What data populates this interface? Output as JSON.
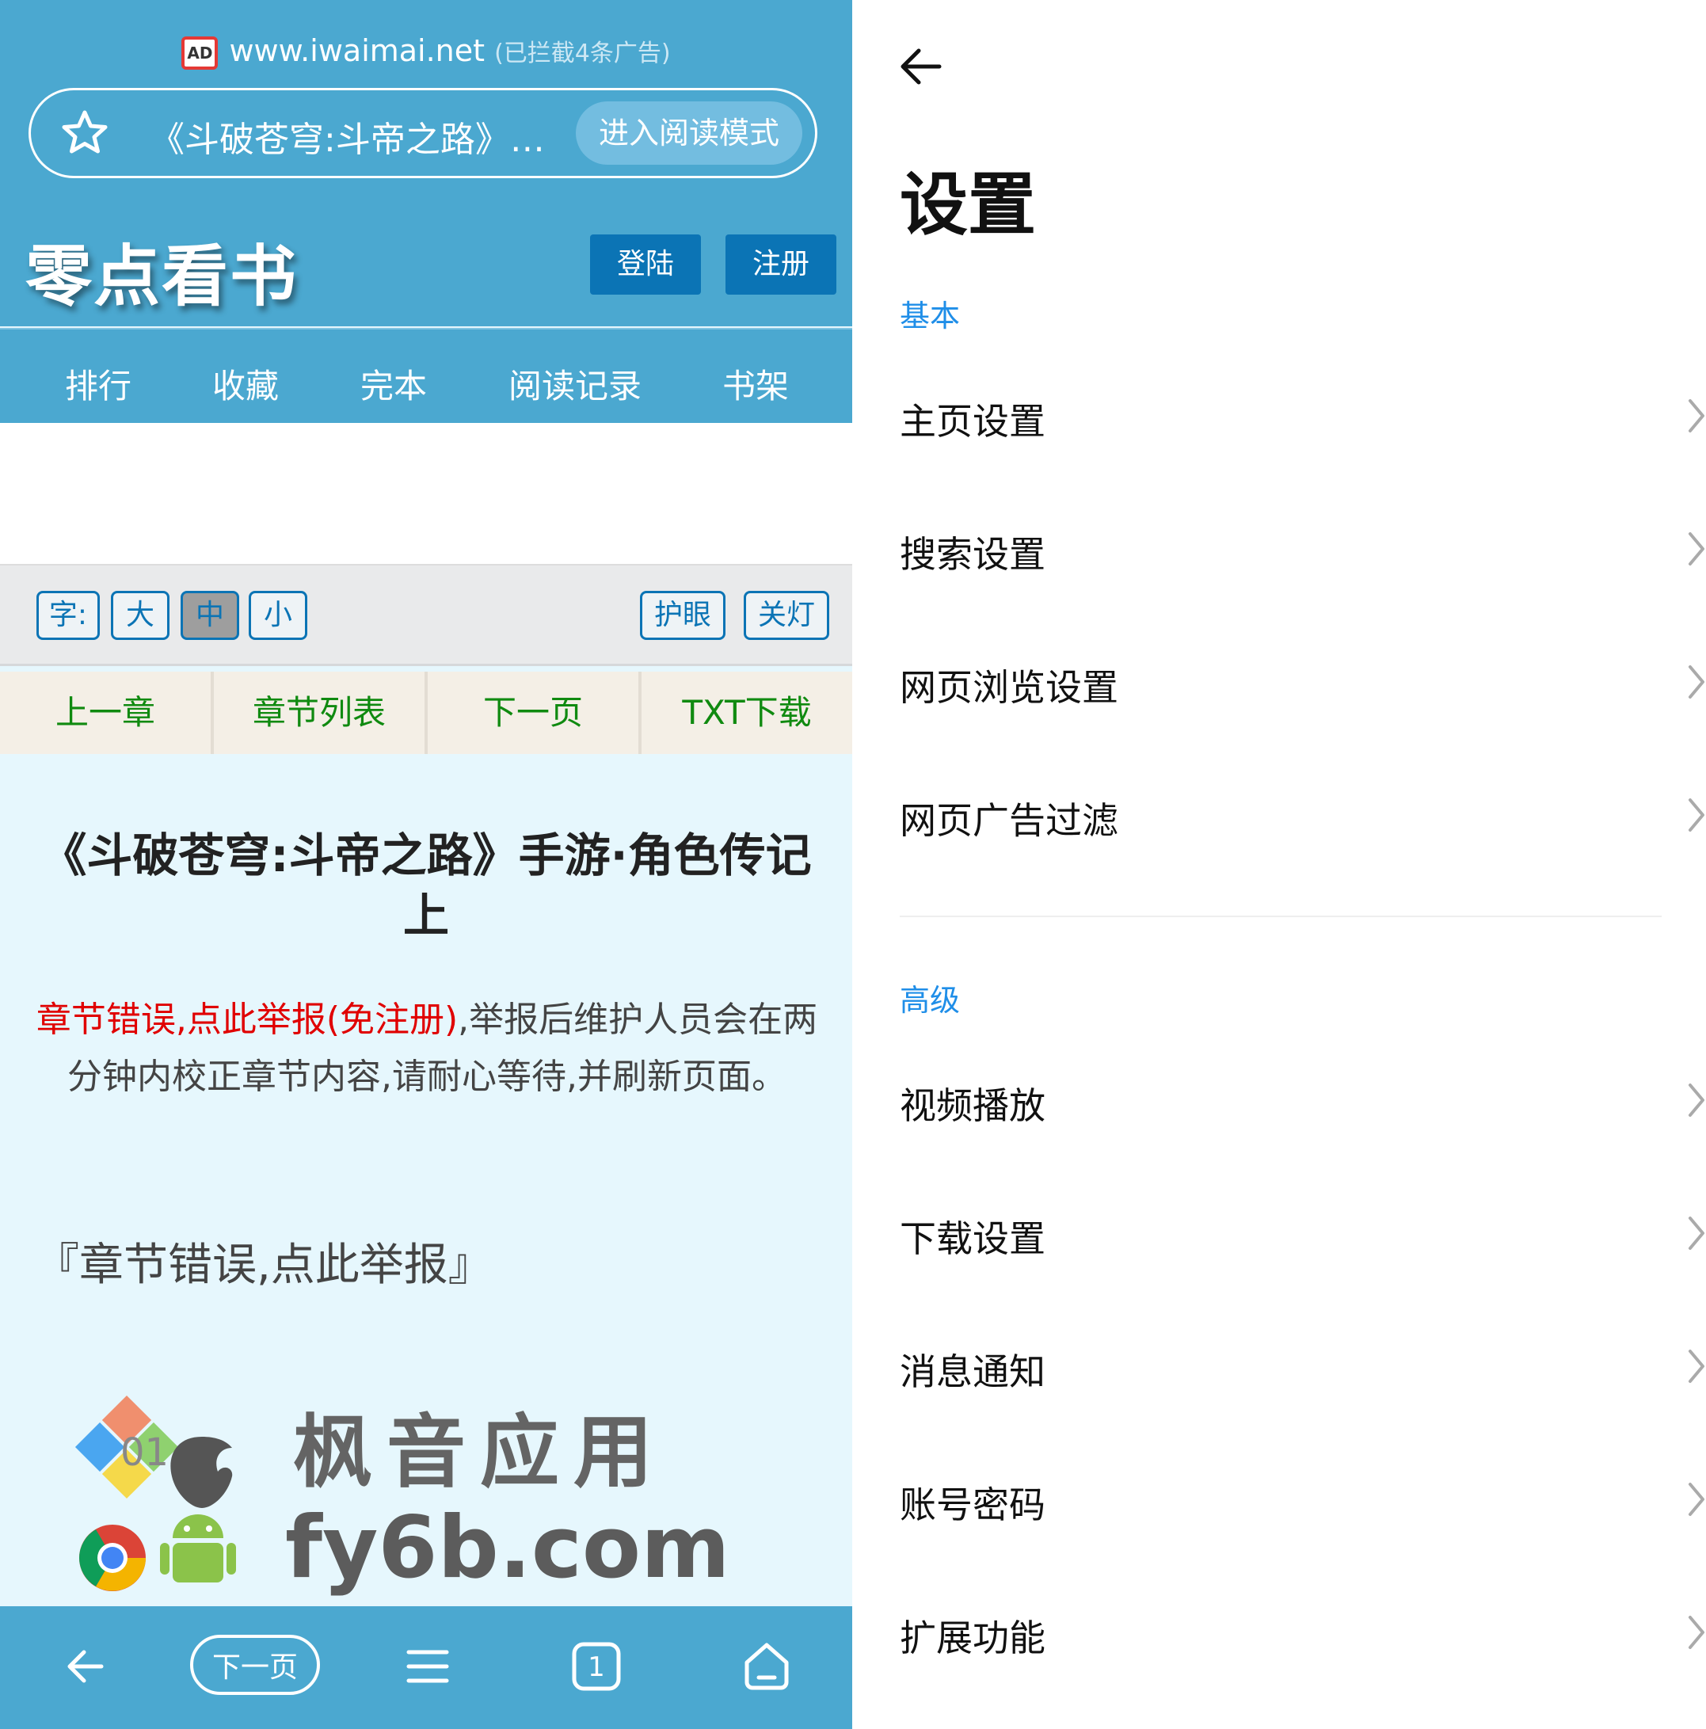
{
  "browser": {
    "url": "www.iwaimai.net",
    "ad_badge": "AD",
    "blocked_note": "(已拦截4条广告)",
    "page_title": "《斗破苍穹:斗帝之路》…",
    "reader_mode_label": "进入阅读模式",
    "site": {
      "logo": "零点看书",
      "login_label": "登陆",
      "register_label": "注册",
      "nav": [
        "排行",
        "收藏",
        "完本",
        "阅读记录",
        "书架"
      ]
    },
    "font_bar": {
      "label": "字:",
      "large": "大",
      "medium": "中",
      "small": "小",
      "eye_care": "护眼",
      "lights_off": "关灯"
    },
    "chapter_nav": [
      "上一章",
      "章节列表",
      "下一页",
      "TXT下载"
    ],
    "content": {
      "title": "《斗破苍穹:斗帝之路》手游·角色传记上",
      "report_red": "章节错误,点此举报(免注册)",
      "report_rest": ",举报后维护人员会在两分钟内校正章节内容,请耐心等待,并刷新页面。",
      "report_link": "『章节错误,点此举报』"
    },
    "watermark": {
      "line1": "枫音应用",
      "line2": "fy6b.com",
      "badge": "01"
    },
    "bottom_bar": {
      "next_page_label": "下一页",
      "tab_count": "1"
    },
    "colors": {
      "bar": "#4ba8d0",
      "button": "#0b74b5",
      "chapter_link": "#108a10",
      "report_red": "#e00000"
    }
  },
  "settings": {
    "title": "设置",
    "sections": [
      {
        "header": "基本",
        "items": [
          "主页设置",
          "搜索设置",
          "网页浏览设置",
          "网页广告过滤"
        ]
      },
      {
        "header": "高级",
        "items": [
          "视频播放",
          "下载设置",
          "消息通知",
          "账号密码",
          "扩展功能"
        ]
      }
    ],
    "colors": {
      "section_header": "#1f8ee8"
    }
  }
}
